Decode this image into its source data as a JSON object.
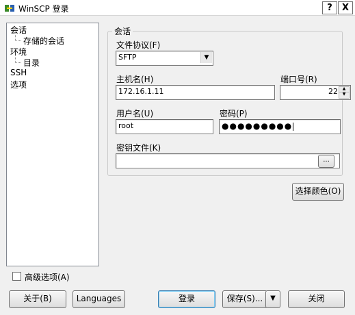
{
  "window": {
    "title": "WinSCP 登录",
    "help_glyph": "?",
    "close_glyph": "X"
  },
  "tree": {
    "items": [
      {
        "label": "会话"
      },
      {
        "label": "存储的会话"
      },
      {
        "label": "环境"
      },
      {
        "label": "目录"
      },
      {
        "label": "SSH"
      },
      {
        "label": "选项"
      }
    ]
  },
  "session": {
    "group_title": "会话",
    "protocol_label": "文件协议(F)",
    "protocol_value": "SFTP",
    "host_label": "主机名(H)",
    "host_value": "172.16.1.11",
    "port_label": "端口号(R)",
    "port_value": "22",
    "user_label": "用户名(U)",
    "user_value": "root",
    "password_label": "密码(P)",
    "password_value": "●●●●●●●●●",
    "keyfile_label": "密钥文件(K)",
    "keyfile_value": "",
    "browse_label": "..."
  },
  "color_button": "选择颜色(O)",
  "advanced_options": {
    "label": "高级选项(A)",
    "checked": false
  },
  "buttons": {
    "about": "关于(B)",
    "languages": "Languages",
    "login": "登录",
    "save": "保存(S)...",
    "save_dropdown": "▼",
    "close": "关闭"
  }
}
